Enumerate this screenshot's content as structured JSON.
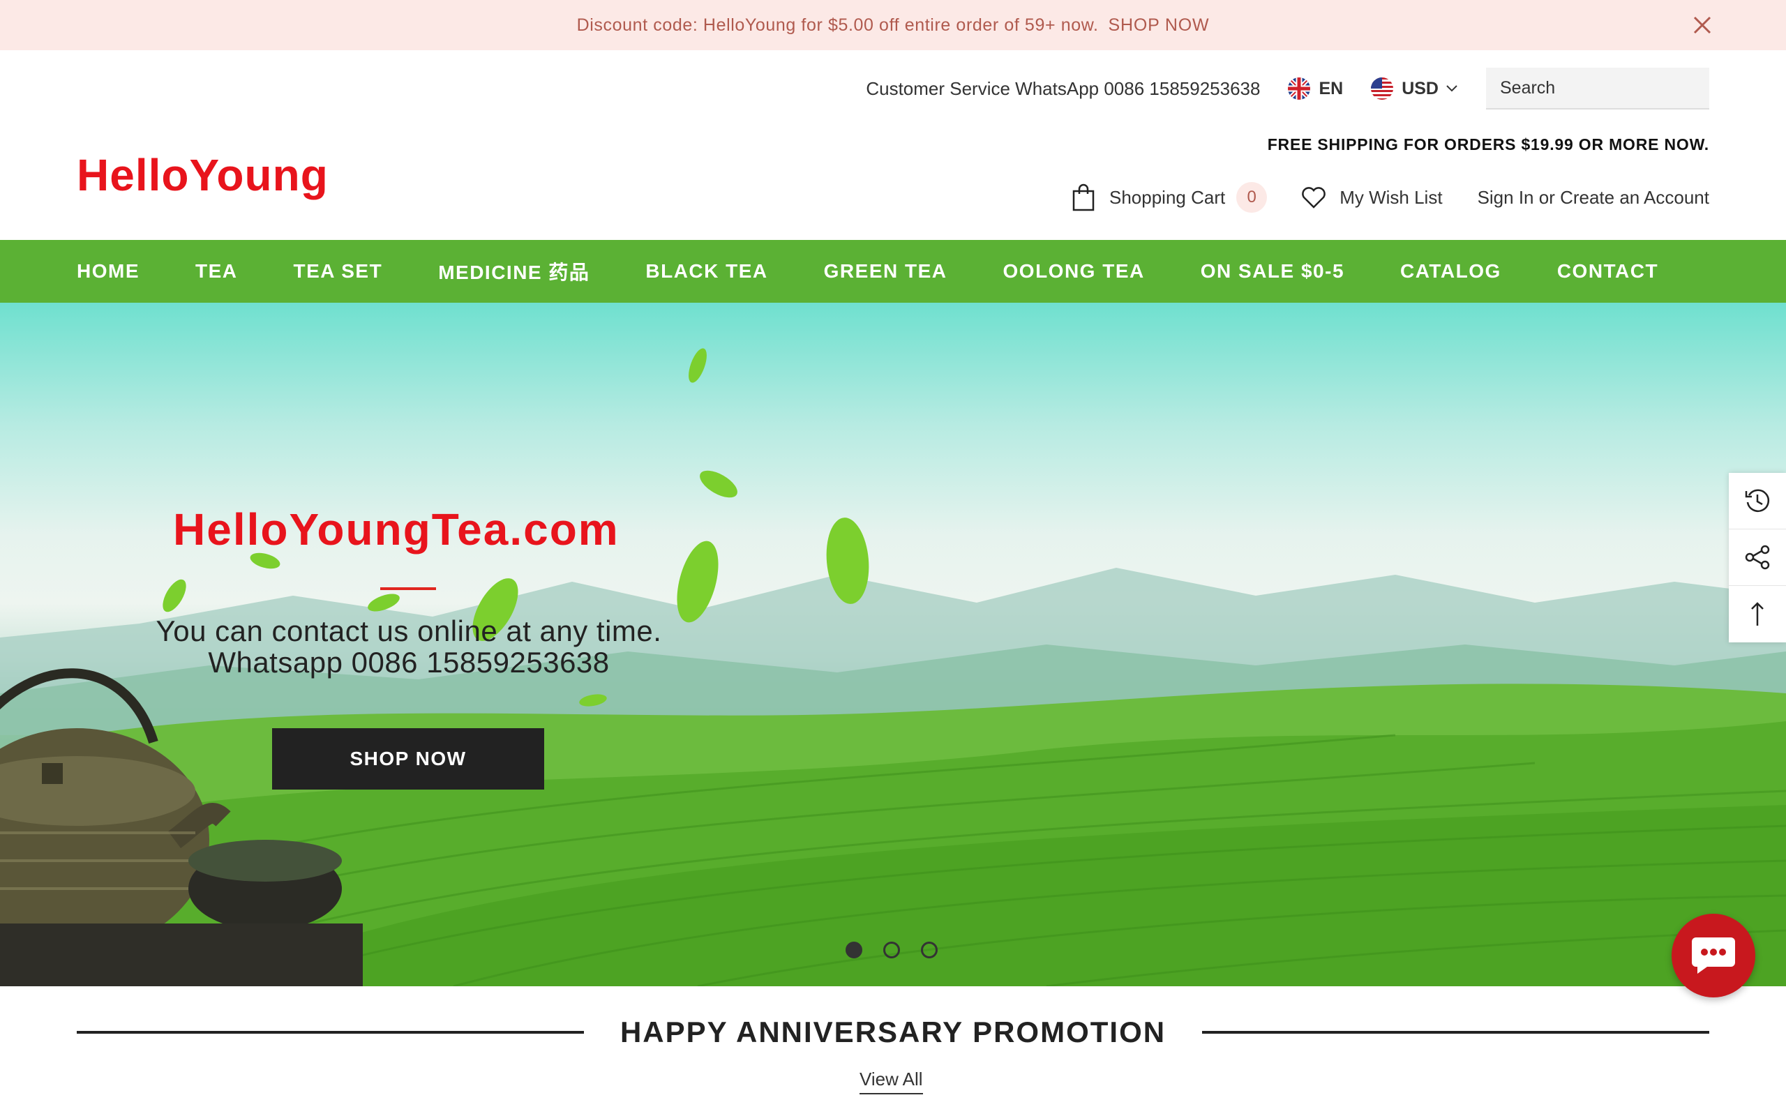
{
  "announcement": {
    "text": "Discount code: HelloYoung for $5.00 off entire order of 59+ now.",
    "link": "SHOP NOW",
    "close_icon": "close-icon"
  },
  "header": {
    "customer_service": "Customer Service WhatsApp 0086 15859253638",
    "language": "EN",
    "currency": "USD",
    "search_placeholder": "Search",
    "logo": "HelloYoung",
    "free_shipping": "FREE SHIPPING FOR ORDERS $19.99 OR MORE NOW.",
    "cart_label": "Shopping Cart",
    "cart_count": "0",
    "wishlist_label": "My Wish List",
    "signin_label": "Sign In or Create an Account"
  },
  "nav": {
    "items": [
      "HOME",
      "TEA",
      "TEA SET",
      "MEDICINE 药品",
      "BLACK TEA",
      "GREEN TEA",
      "OOLONG TEA",
      "ON SALE $0-5",
      "CATALOG",
      "CONTACT"
    ]
  },
  "hero": {
    "title": "HelloYoungTea.com",
    "subtitle_line1": "You can contact us online at any time.",
    "subtitle_line2": "Whatsapp 0086 15859253638",
    "button": "SHOP NOW",
    "slides": 3,
    "active_slide": 1
  },
  "side_tools": [
    "history-icon",
    "share-icon",
    "back-to-top-icon"
  ],
  "promotion": {
    "title": "HAPPY ANNIVERSARY PROMOTION",
    "view_all": "View All"
  },
  "colors": {
    "brand_red": "#e8141c",
    "nav_green": "#5bb134",
    "announce_bg": "#fce9e6",
    "chat_red": "#c8181e"
  }
}
